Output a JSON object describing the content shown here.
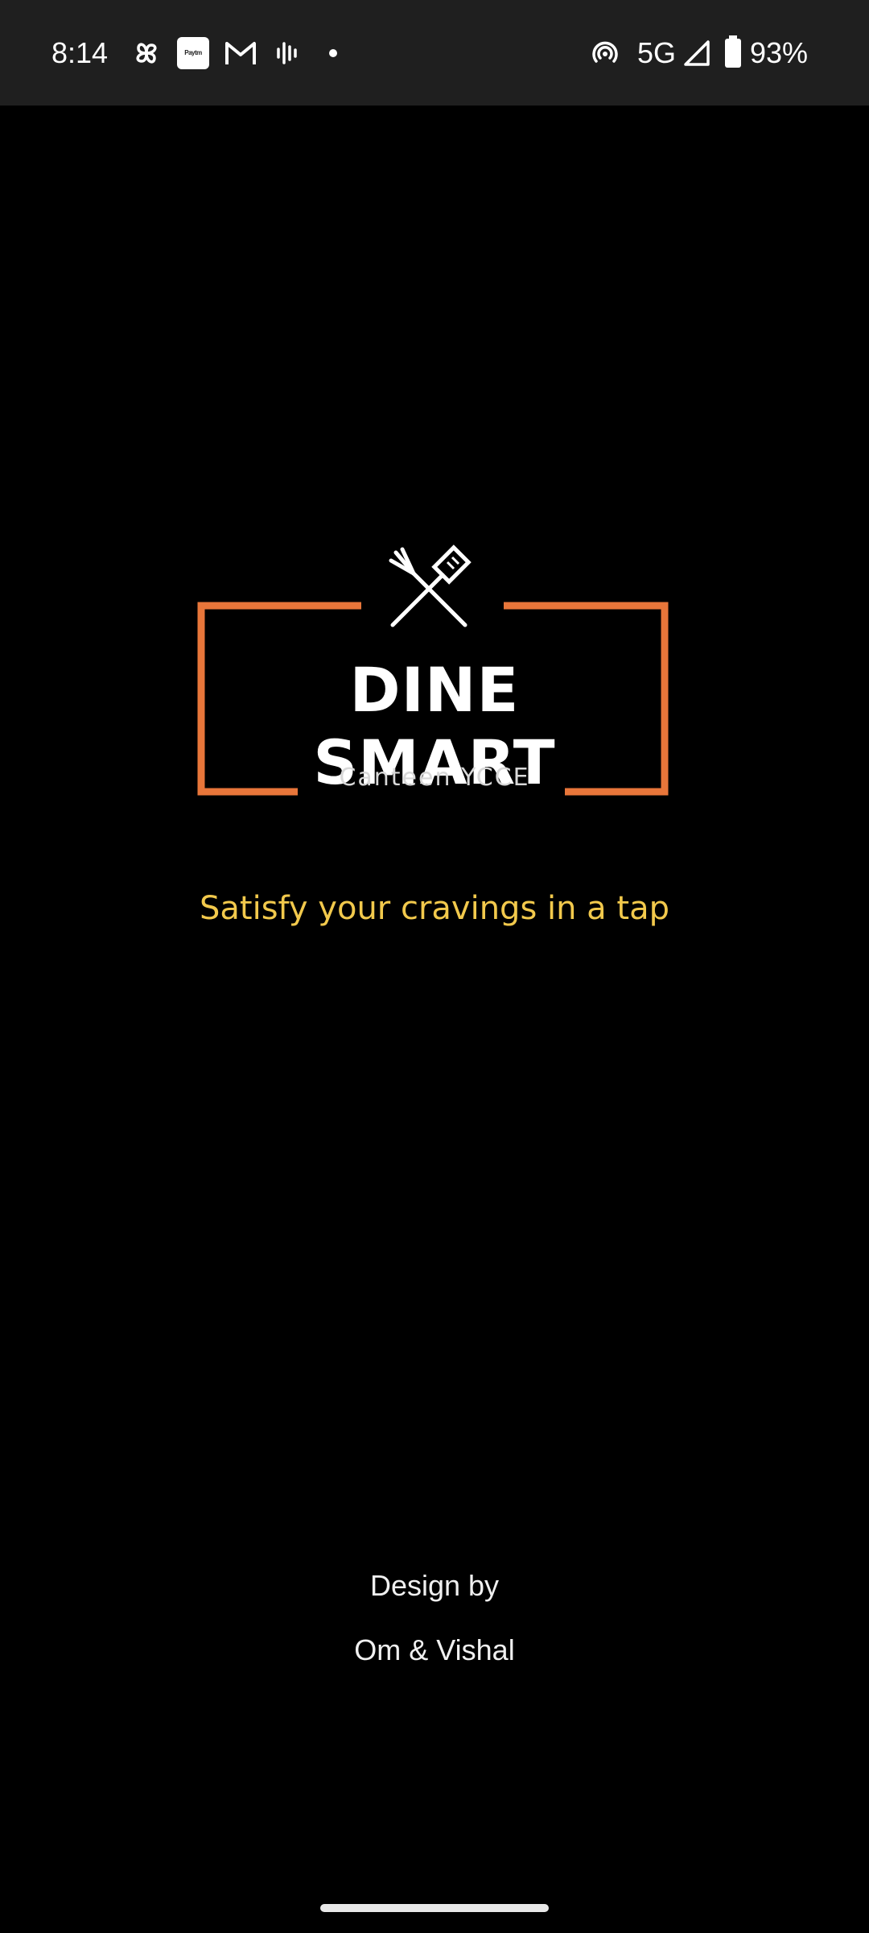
{
  "status_bar": {
    "time": "8:14",
    "notification_icons": [
      "pinwheel-icon",
      "paytm-icon",
      "gmail-icon",
      "voice-icon",
      "dot-icon"
    ],
    "paytm_label": "Paytm",
    "network": "5G",
    "battery": "93%",
    "system_icons": [
      "hotspot-icon",
      "signal-icon",
      "battery-icon"
    ]
  },
  "logo": {
    "title": "DINE SMART",
    "subtitle": "Canteen YCCE",
    "icon": "fork-spatula-icon",
    "accent_color": "#e8763a"
  },
  "tagline": "Satisfy your cravings in a tap",
  "tagline_color": "#f2c94c",
  "credits": {
    "label": "Design by",
    "names": "Om & Vishal"
  }
}
